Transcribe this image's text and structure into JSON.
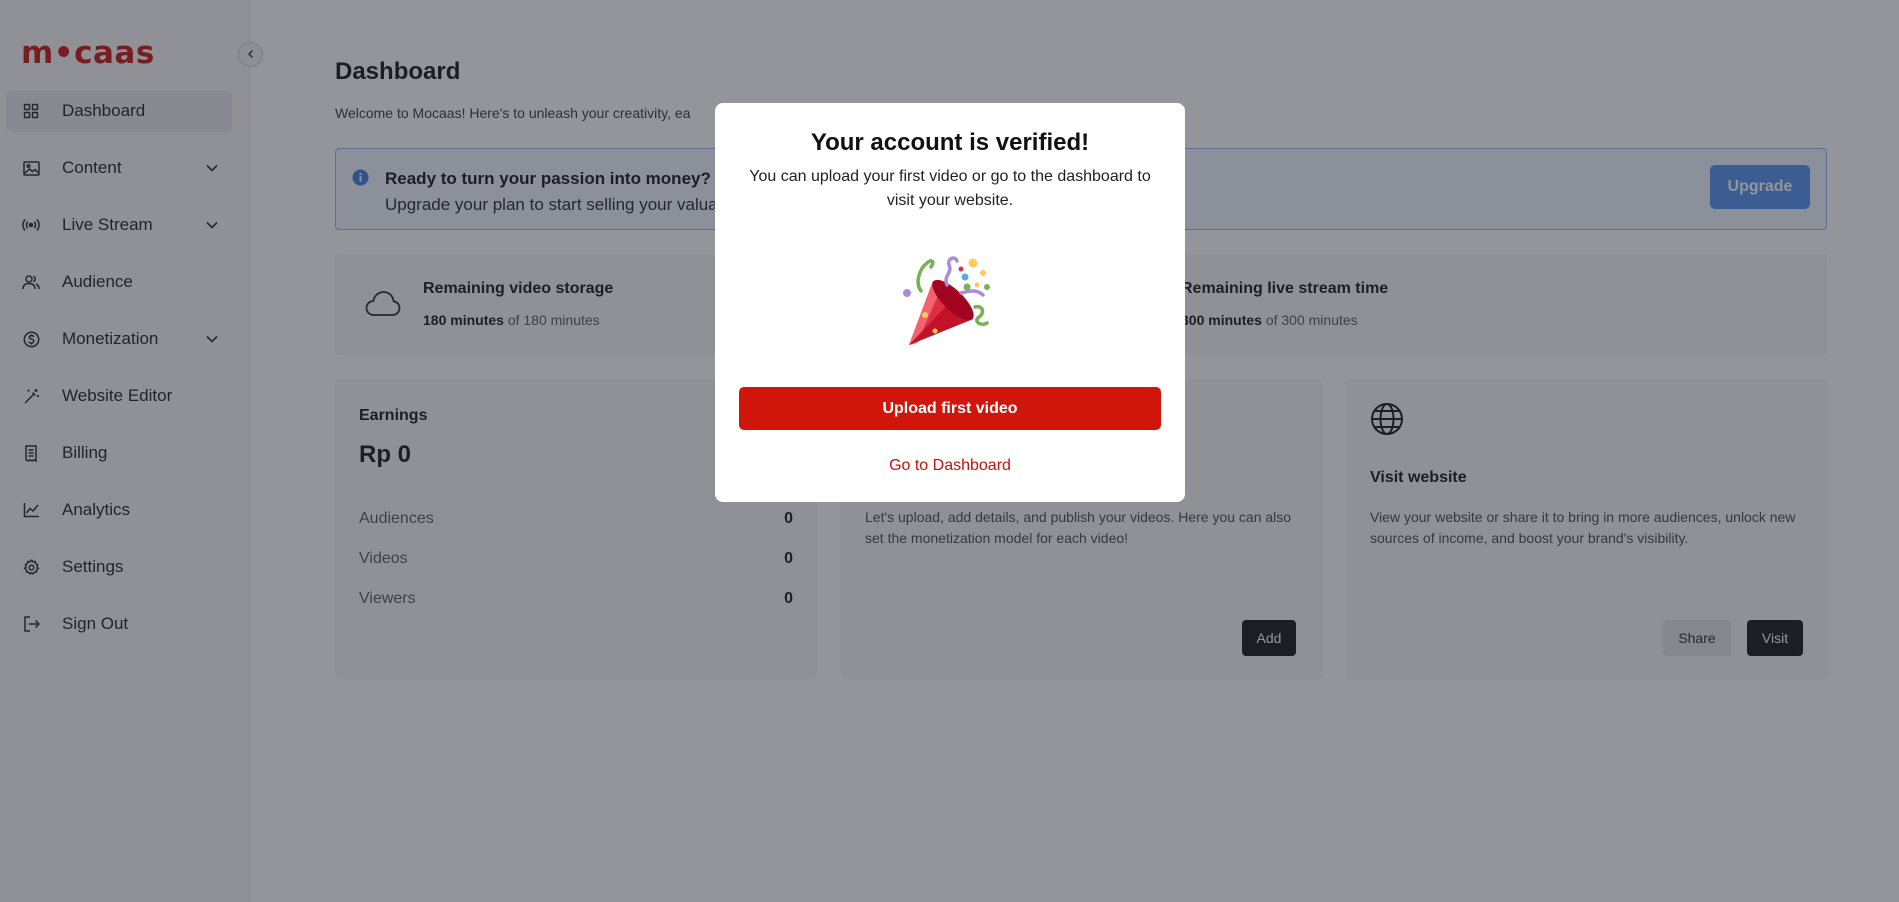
{
  "brand": {
    "logo_text": "m•caas",
    "accent_color": "#c8100a"
  },
  "sidebar": {
    "items": [
      {
        "label": "Dashboard",
        "icon": "grid-icon",
        "active": true,
        "has_chevron": false
      },
      {
        "label": "Content",
        "icon": "image-icon",
        "active": false,
        "has_chevron": true
      },
      {
        "label": "Live Stream",
        "icon": "broadcast-icon",
        "active": false,
        "has_chevron": true
      },
      {
        "label": "Audience",
        "icon": "users-icon",
        "active": false,
        "has_chevron": false
      },
      {
        "label": "Monetization",
        "icon": "dollar-circle-icon",
        "active": false,
        "has_chevron": true
      },
      {
        "label": "Website Editor",
        "icon": "magic-wand-icon",
        "active": false,
        "has_chevron": false
      },
      {
        "label": "Billing",
        "icon": "receipt-icon",
        "active": false,
        "has_chevron": false
      },
      {
        "label": "Analytics",
        "icon": "line-chart-icon",
        "active": false,
        "has_chevron": false
      },
      {
        "label": "Settings",
        "icon": "gear-icon",
        "active": false,
        "has_chevron": false
      },
      {
        "label": "Sign Out",
        "icon": "sign-out-icon",
        "active": false,
        "has_chevron": false
      }
    ]
  },
  "main": {
    "title": "Dashboard",
    "subtitle": "Welcome to Mocaas! Here's to unleash your creativity, ea",
    "banner": {
      "title": "Ready to turn your passion into money?",
      "text": "Upgrade your plan to start selling your valua",
      "button_label": "Upgrade"
    },
    "storage": {
      "video_title": "Remaining video storage",
      "video_value": "180 minutes",
      "video_total": "of 180 minutes",
      "live_title": "Remaining live stream time",
      "live_value": "300 minutes",
      "live_total": "of 300 minutes"
    },
    "earnings": {
      "label": "Earnings",
      "value": "Rp 0",
      "rows": [
        {
          "label": "Audiences",
          "value": "0"
        },
        {
          "label": "Videos",
          "value": "0"
        },
        {
          "label": "Viewers",
          "value": "0"
        }
      ]
    },
    "upload_card": {
      "description": "Let's upload, add details, and publish your videos. Here you can also set the monetization model for each video!",
      "button_label": "Add"
    },
    "website_card": {
      "heading": "Visit website",
      "description": "View your website or share it to bring in more audiences, unlock new sources of income, and boost your brand's visibility.",
      "share_label": "Share",
      "visit_label": "Visit"
    }
  },
  "modal": {
    "title": "Your account is verified!",
    "subtitle": "You can upload your first video or go to the dashboard to visit your website.",
    "primary_label": "Upload first video",
    "link_label": "Go to Dashboard"
  }
}
